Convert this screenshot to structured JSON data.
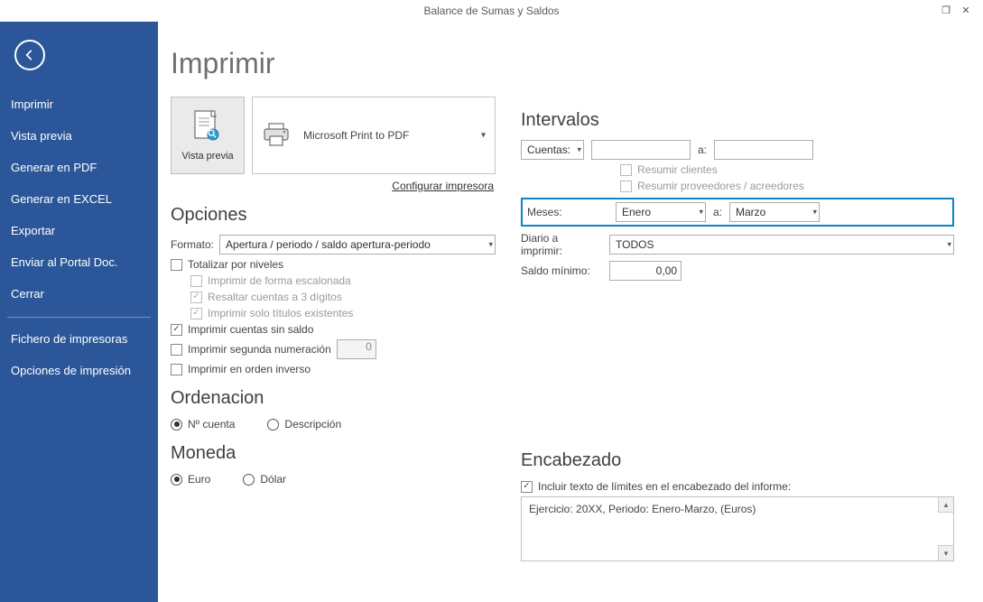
{
  "title": "Balance de Sumas y Saldos",
  "sidebar": {
    "items": [
      "Imprimir",
      "Vista previa",
      "Generar en PDF",
      "Generar en EXCEL",
      "Exportar",
      "Enviar al Portal Doc.",
      "Cerrar"
    ],
    "items2": [
      "Fichero de impresoras",
      "Opciones de impresión"
    ]
  },
  "page_title": "Imprimir",
  "preview_label": "Vista previa",
  "printer_name": "Microsoft Print to PDF",
  "config_link": "Configurar impresora",
  "opciones": {
    "heading": "Opciones",
    "formato_label": "Formato:",
    "formato_value": "Apertura / periodo / saldo apertura-periodo",
    "totalizar": "Totalizar por niveles",
    "escalonada": "Imprimir de forma escalonada",
    "resaltar": "Resaltar cuentas a 3 dígitos",
    "solo_titulos": "Imprimir solo títulos existentes",
    "sin_saldo": "Imprimir cuentas sin saldo",
    "segunda_num": "Imprimir segunda numeración",
    "segunda_num_val": "0",
    "orden_inverso": "Imprimir en orden inverso"
  },
  "ordenacion": {
    "heading": "Ordenacion",
    "op1": "Nº cuenta",
    "op2": "Descripción"
  },
  "moneda": {
    "heading": "Moneda",
    "op1": "Euro",
    "op2": "Dólar"
  },
  "intervalos": {
    "heading": "Intervalos",
    "cuentas_label": "Cuentas:",
    "a": "a:",
    "resumir_clientes": "Resumir clientes",
    "resumir_prov": "Resumir proveedores / acreedores",
    "meses_label": "Meses:",
    "mes_from": "Enero",
    "mes_to": "Marzo",
    "diario_label": "Diario a imprimir:",
    "diario_value": "TODOS",
    "saldo_min_label": "Saldo mínimo:",
    "saldo_min_val": "0,00"
  },
  "encabezado": {
    "heading": "Encabezado",
    "incluir": "Incluir texto de límites en el encabezado del informe:",
    "preview_text": "Ejercicio: 20XX, Periodo: Enero-Marzo, (Euros)"
  }
}
